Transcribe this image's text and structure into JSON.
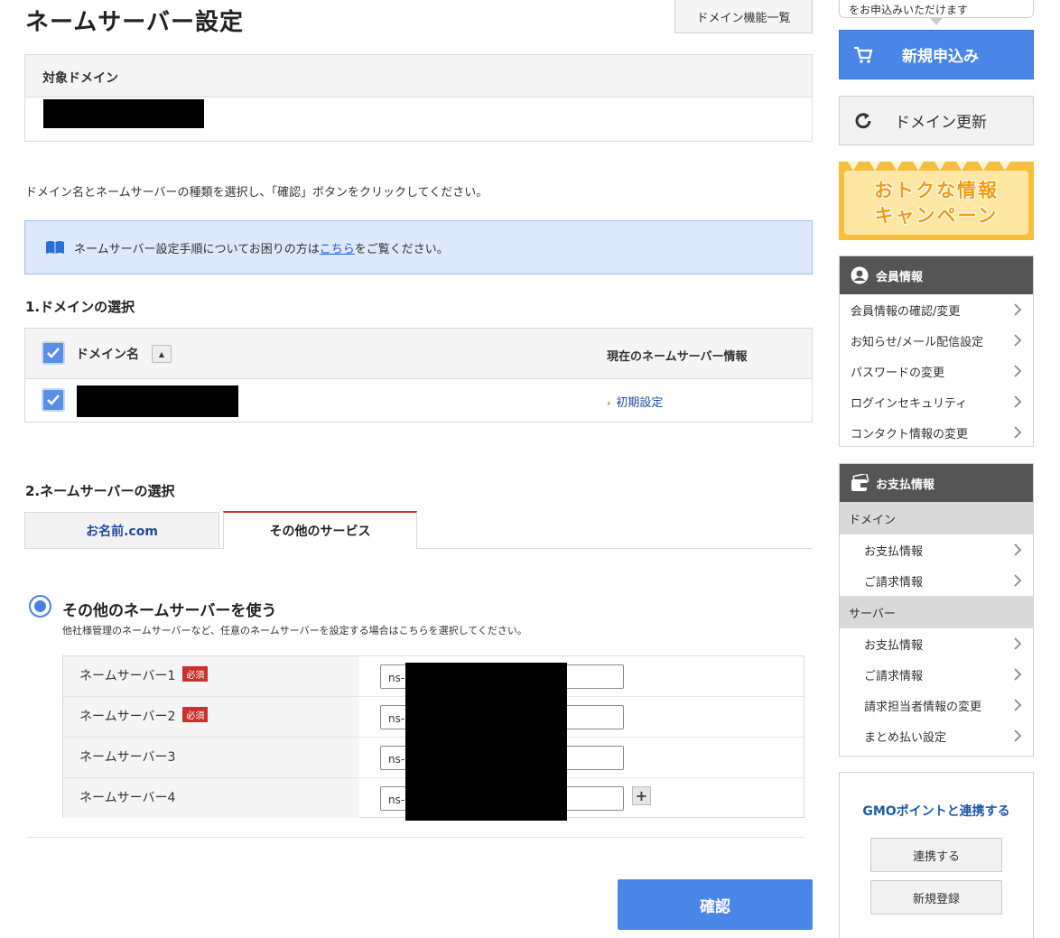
{
  "header": {
    "title": "ネームサーバー設定",
    "domain_func_button": "ドメイン機能一覧"
  },
  "target": {
    "label": "対象ドメイン"
  },
  "instruction": "ドメイン名とネームサーバーの種類を選択し、「確認」ボタンをクリックしてください。",
  "info": {
    "text_before": "ネームサーバー設定手順についてお困りの方は",
    "link": "こちら",
    "text_after": "をご覧ください。"
  },
  "section1": {
    "title": "1.ドメインの選択",
    "col_domain": "ドメイン名",
    "col_current": "現在のネームサーバー情報",
    "row_status": "初期設定"
  },
  "section2": {
    "title": "2.ネームサーバーの選択",
    "tabs": [
      "お名前.com",
      "その他のサービス"
    ],
    "option_title": "その他のネームサーバーを使う",
    "option_desc": "他社様管理のネームサーバーなど、任意のネームサーバーを設定する場合はこちらを選択してください。",
    "required_badge": "必須",
    "ns_rows": [
      {
        "label": "ネームサーバー1",
        "value": "ns-",
        "required": true
      },
      {
        "label": "ネームサーバー2",
        "value": "ns-",
        "required": true
      },
      {
        "label": "ネームサーバー3",
        "value": "ns-",
        "required": false
      },
      {
        "label": "ネームサーバー4",
        "value": "ns-",
        "required": false
      }
    ],
    "plus": "+",
    "confirm_button": "確認"
  },
  "sidebar": {
    "bubble": "をお申込みいただけます",
    "new_button": "新規申込み",
    "renew_button": "ドメイン更新",
    "campaign_line1": "おトクな情報",
    "campaign_line2": "キャンペーン",
    "member": {
      "title": "会員情報",
      "items": [
        "会員情報の確認/変更",
        "お知らせ/メール配信設定",
        "パスワードの変更",
        "ログインセキュリティ",
        "コンタクト情報の変更"
      ]
    },
    "payment": {
      "title": "お支払情報",
      "cat_domain": "ドメイン",
      "domain_items": [
        "お支払情報",
        "ご請求情報"
      ],
      "cat_server": "サーバー",
      "server_items": [
        "お支払情報",
        "ご請求情報",
        "請求担当者情報の変更",
        "まとめ払い設定"
      ]
    },
    "gmo": {
      "title": "GMOポイントと連携する",
      "link_button": "連携する",
      "register_button": "新規登録"
    }
  },
  "colors": {
    "primary_blue": "#4a86e8",
    "required_red": "#c9322b",
    "info_bg": "#dde9fb"
  }
}
